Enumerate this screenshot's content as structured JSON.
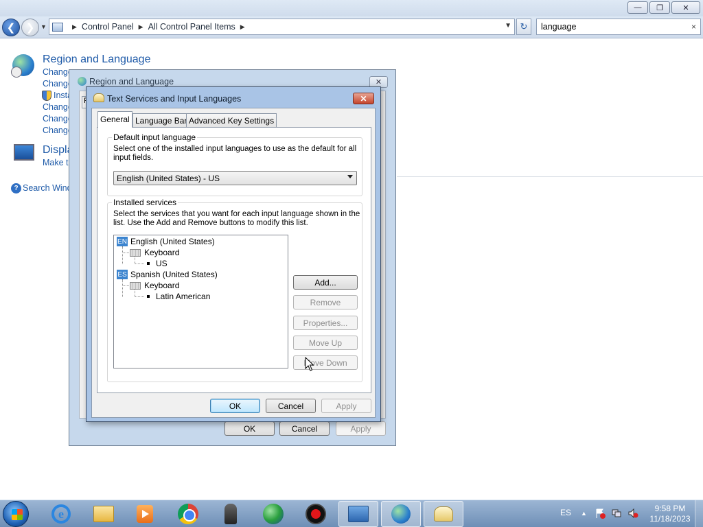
{
  "explorer": {
    "breadcrumb": [
      "Control Panel",
      "All Control Panel Items"
    ],
    "search_value": "language",
    "search_clear_glyph": "×"
  },
  "control_panel": {
    "region_heading": "Region and Language",
    "region_links": [
      "Change",
      "Change",
      "Insta",
      "Change",
      "Change",
      "Change"
    ],
    "display_heading": "Displa",
    "display_link": "Make te",
    "help_link": "Search Wind"
  },
  "region_dialog": {
    "title": "Region and Language",
    "tab_stub": "F",
    "buttons": {
      "ok": "OK",
      "cancel": "Cancel",
      "apply": "Apply"
    }
  },
  "text_services_dialog": {
    "title": "Text Services and Input Languages",
    "tabs": [
      "General",
      "Language Bar",
      "Advanced Key Settings"
    ],
    "default_input": {
      "legend": "Default input language",
      "description": "Select one of the installed input languages to use as the default for all input fields.",
      "selected": "English (United States) - US"
    },
    "installed_services": {
      "legend": "Installed services",
      "description": "Select the services that you want for each input language shown in the list. Use the Add and Remove buttons to modify this list.",
      "languages": [
        {
          "badge": "EN",
          "name": "English (United States)",
          "category": "Keyboard",
          "layout": "US"
        },
        {
          "badge": "ES",
          "name": "Spanish (United States)",
          "category": "Keyboard",
          "layout": "Latin American"
        }
      ],
      "buttons": {
        "add": "Add...",
        "remove": "Remove",
        "properties": "Properties...",
        "move_up": "Move Up",
        "move_down": "Move Down"
      }
    },
    "buttons": {
      "ok": "OK",
      "cancel": "Cancel",
      "apply": "Apply"
    }
  },
  "taskbar": {
    "input_language": "ES",
    "time": "9:58 PM",
    "date": "11/18/2023"
  }
}
